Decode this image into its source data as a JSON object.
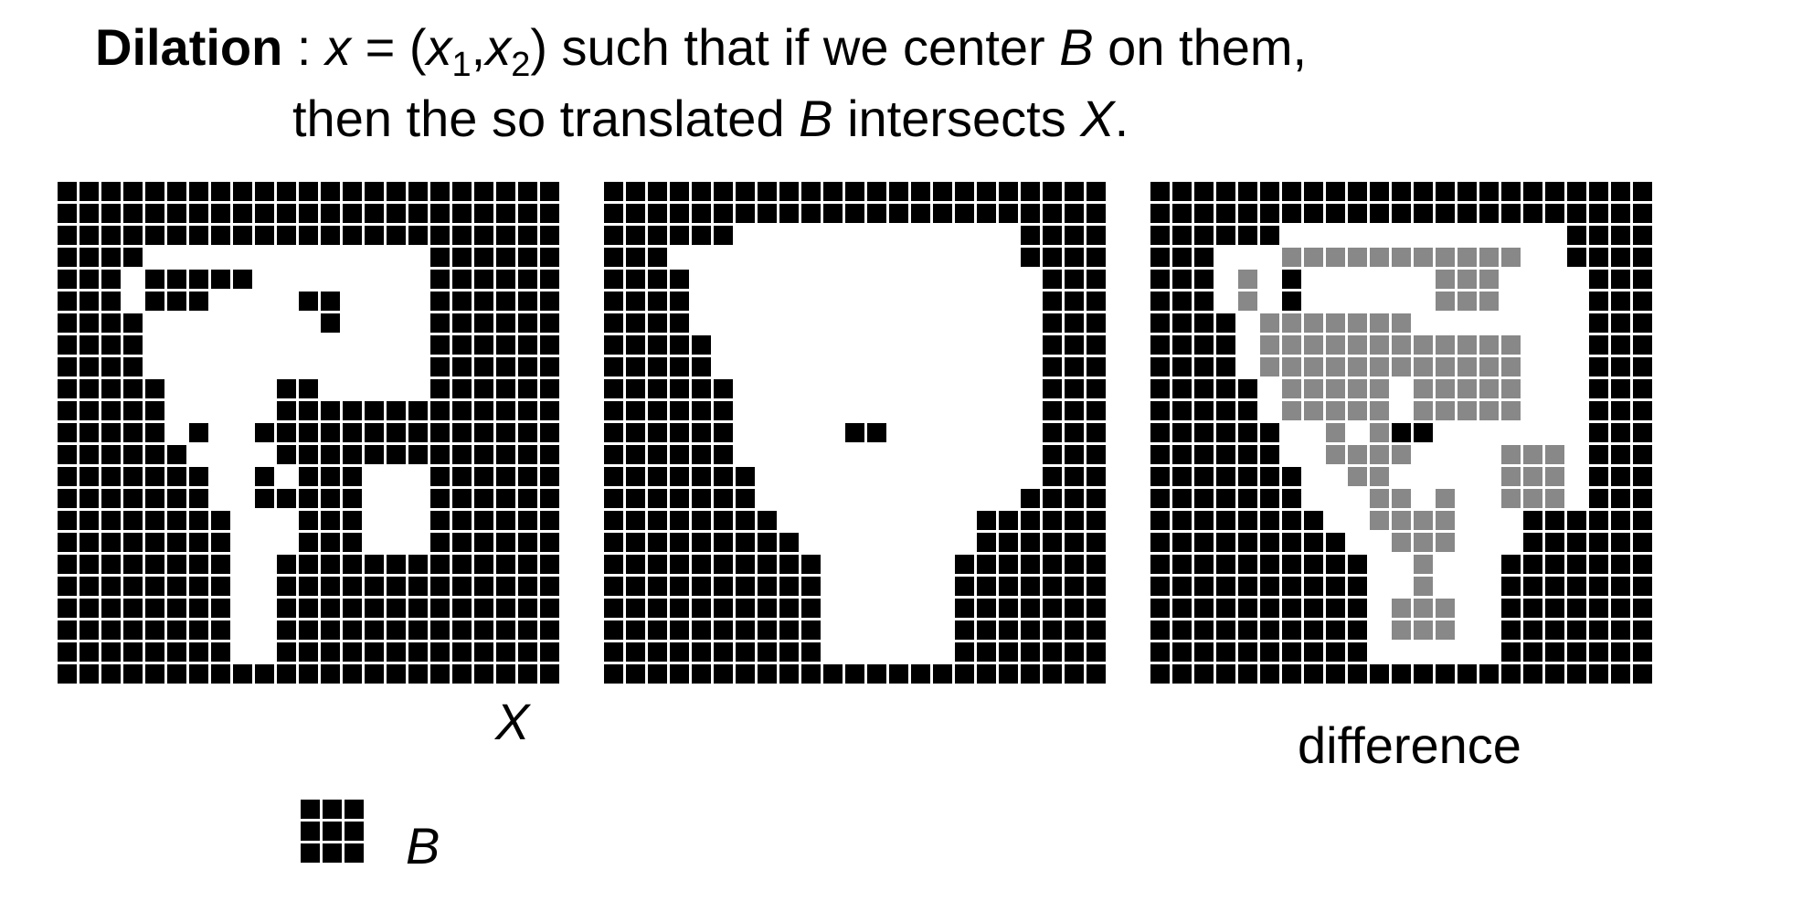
{
  "title": {
    "bold_word": "Dilation",
    "colon": " : ",
    "var_x": "x",
    "eq": " = (",
    "x1_base": "x",
    "x1_sub": "1",
    "comma": ",",
    "x2_base": "x",
    "x2_sub": "2",
    "rest1": ") such that if we center ",
    "var_b": "B",
    "rest2": " on them,",
    "line2_a": "then the so translated ",
    "line2_b_var": "B",
    "line2_c": " intersects ",
    "line2_x_var": "X",
    "line2_end": "."
  },
  "labels": {
    "x": "X",
    "difference": "difference",
    "b": "B"
  },
  "colors": {
    "black": "#000000",
    "white": "#ffffff",
    "gray": "#888888"
  },
  "grids": {
    "x": [
      "00000000000000000000000",
      "00000000000000000000000",
      "00000000000000000000000",
      "00001111111111111000000",
      "00010000011111111000000",
      "00010001111001111000000",
      "00001111111101111000000",
      "00001111111111111000000",
      "00001111111111111000000",
      "00000111110011111000000",
      "00000111110000000000000",
      "00000101100000000000000",
      "00000011110000000000000",
      "00000001101000111000000",
      "00000001100000111000000",
      "00000000111000111000000",
      "00000000111000111000000",
      "00000000110000000000000",
      "00000000110000000000000",
      "00000000110000000000000",
      "00000000110000000000000",
      "00000000110000000000000",
      "00000000000000000000000"
    ],
    "dilated": [
      "00000000000000000000000",
      "00000000000000000000000",
      "00000011111111111110000",
      "00011111111111111110000",
      "00001111111111111111000",
      "00001111111111111111000",
      "00001111111111111111000",
      "00000111111111111111000",
      "00000111111111111111000",
      "00000011111111111111000",
      "00000011111111111111000",
      "00000011111001111111000",
      "00000011111111111111000",
      "00000001111111111111000",
      "00000001111111111110000",
      "00000000111111111000000",
      "00000000011111111000000",
      "00000000001111110000000",
      "00000000001111110000000",
      "00000000001111110000000",
      "00000000001111110000000",
      "00000000001111110000000",
      "00000000000000000000000"
    ],
    "diff": [
      "00000000000000000000000",
      "00000000000000000000000",
      "00000011111111111110000",
      "00011122222222222110000",
      "00012101111112221111000",
      "00012101111112221111000",
      "00001222222211111111000",
      "00001222222222222111000",
      "00001222222222222111000",
      "00000122222122222111000",
      "00000122222122222111000",
      "00000011212001111111000",
      "00000011222211112221000",
      "00000001122111112221000",
      "00000001112212112221000",
      "00000000112222111000000",
      "00000000011222111000000",
      "00000000001121110000000",
      "00000000001121110000000",
      "00000000001222110000000",
      "00000000001222110000000",
      "00000000001111110000000",
      "00000000000000000000000"
    ],
    "b": [
      "11111",
      "10001",
      "10001",
      "10001",
      "11111"
    ]
  }
}
